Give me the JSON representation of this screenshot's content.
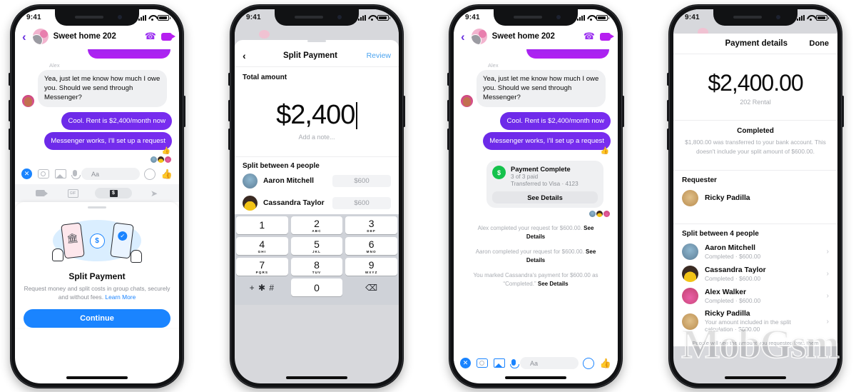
{
  "status_bar": {
    "time": "9:41"
  },
  "phone1": {
    "chat": {
      "title": "Sweet home 202",
      "sender_label": "Alex",
      "incoming_message": "Yea, just let me know how much I owe you. Should we send through Messenger?",
      "outgoing_messages": [
        "Cool. Rent is $2,400/month now",
        "Messenger works, I'll set up a request"
      ],
      "reaction": "👍"
    },
    "composer": {
      "placeholder": "Aa"
    },
    "sheet": {
      "title": "Split Payment",
      "subtitle": "Request money and split costs in group chats, securely and without fees.",
      "link": "Learn More",
      "cta": "Continue"
    }
  },
  "phone2": {
    "nav": {
      "title": "Split Payment",
      "action": "Review"
    },
    "total_label": "Total amount",
    "amount": "$2,400",
    "note_placeholder": "Add a note...",
    "split_label": "Split between 4 people",
    "people": [
      {
        "name": "Aaron Mitchell",
        "amount": "$600"
      },
      {
        "name": "Cassandra Taylor",
        "amount": "$600"
      }
    ],
    "keypad": [
      {
        "n": "1",
        "l": ""
      },
      {
        "n": "2",
        "l": "ABC"
      },
      {
        "n": "3",
        "l": "DEF"
      },
      {
        "n": "4",
        "l": "GHI"
      },
      {
        "n": "5",
        "l": "JKL"
      },
      {
        "n": "6",
        "l": "MNO"
      },
      {
        "n": "7",
        "l": "PQRS"
      },
      {
        "n": "8",
        "l": "TUV"
      },
      {
        "n": "9",
        "l": "WXYZ"
      },
      {
        "n": "+ ✱ #",
        "l": ""
      },
      {
        "n": "0",
        "l": ""
      },
      {
        "n": "⌫",
        "l": ""
      }
    ]
  },
  "phone3": {
    "chat": {
      "title": "Sweet home 202",
      "sender_label": "Alex",
      "incoming_message": "Yea, just let me know how much I owe you. Should we send through Messenger?",
      "outgoing_messages": [
        "Cool. Rent is $2,400/month now",
        "Messenger works, I'll set up a request"
      ]
    },
    "payment_card": {
      "title": "Payment Complete",
      "line1": "3 of 3 paid",
      "line2": "Transferred to Visa · 4123",
      "button": "See Details"
    },
    "system_messages": [
      {
        "text": "Alex completed your request for $600.00.",
        "link": "See Details"
      },
      {
        "text": "Aaron completed your request for $600.00.",
        "link": "See Details"
      },
      {
        "text": "You marked Cassandra's payment for $600.00 as “Completed.”",
        "link": "See Details"
      }
    ],
    "composer": {
      "placeholder": "Aa"
    }
  },
  "phone4": {
    "nav": {
      "title": "Payment details",
      "action": "Done"
    },
    "amount": "$2,400.00",
    "amount_sub": "202 Rental",
    "status_title": "Completed",
    "status_desc": "$1,800.00 was transferred to your bank account. This doesn't include your split amount of $600.00.",
    "requester_label": "Requester",
    "requester_name": "Ricky Padilla",
    "split_label": "Split between 4 people",
    "people": [
      {
        "name": "Aaron Mitchell",
        "sub": "Completed · $600.00"
      },
      {
        "name": "Cassandra Taylor",
        "sub": "Completed · $600.00"
      },
      {
        "name": "Alex Walker",
        "sub": "Completed · $600.00"
      },
      {
        "name": "Ricky Padilla",
        "sub": "Your amount included in the split calculation · $600.00"
      }
    ],
    "footer": "People will see the amount you requested from them"
  },
  "watermark": "MobGsm",
  "colors": {
    "messenger_blue": "#1a84ff",
    "bubble_purple": "#6b2ae8",
    "green": "#15c24c",
    "link_blue": "#4aa3ef"
  }
}
